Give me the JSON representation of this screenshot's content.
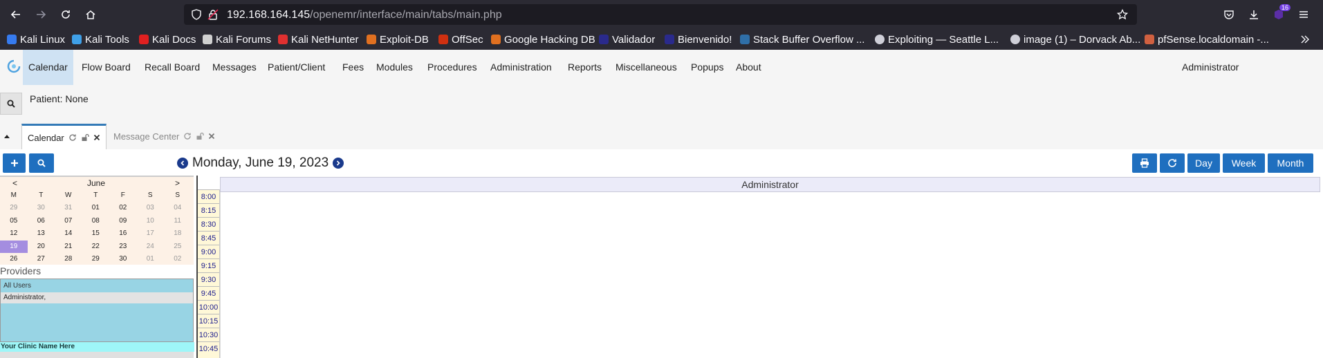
{
  "browser": {
    "url_host": "192.168.164.145",
    "url_path": "/openemr/interface/main/tabs/main.php",
    "badge_count": "16",
    "bookmarks": [
      {
        "label": "Kali Linux",
        "color": "#367bf0"
      },
      {
        "label": "Kali Tools",
        "color": "#3fa0e8"
      },
      {
        "label": "Kali Docs",
        "color": "#e02020"
      },
      {
        "label": "Kali Forums",
        "color": "#d0d0d0"
      },
      {
        "label": "Kali NetHunter",
        "color": "#e03030"
      },
      {
        "label": "Exploit-DB",
        "color": "#e07020"
      },
      {
        "label": "OffSec",
        "color": "#d03010"
      },
      {
        "label": "Google Hacking DB",
        "color": "#e07020"
      },
      {
        "label": "Validador",
        "color": "#2a2a8c"
      },
      {
        "label": "Bienvenido!",
        "color": "#2a2a8c"
      },
      {
        "label": "Stack Buffer Overflow ...",
        "color": "#2f6fa8"
      },
      {
        "label": "Exploiting — Seattle L...",
        "color": "#cfcfd8"
      },
      {
        "label": "image (1) – Dorvack Ab...",
        "color": "#cfcfd8"
      },
      {
        "label": "pfSense.localdomain -...",
        "color": "#d06040"
      }
    ]
  },
  "app": {
    "nav": [
      "Calendar",
      "Flow Board",
      "Recall Board",
      "Messages",
      "Patient/Client",
      "Fees",
      "Modules",
      "Procedures",
      "Administration",
      "Reports",
      "Miscellaneous",
      "Popups",
      "About"
    ],
    "user": "Administrator",
    "patient_label": "Patient: None",
    "tabs": [
      {
        "label": "Calendar",
        "active": true
      },
      {
        "label": "Message Center",
        "active": false
      }
    ]
  },
  "calendar": {
    "date_title": "Monday, June 19, 2023",
    "view_buttons": [
      "Day",
      "Week",
      "Month"
    ],
    "mini": {
      "prev": "<",
      "month": "June",
      "next": ">",
      "weekdays": [
        "M",
        "T",
        "W",
        "T",
        "F",
        "S",
        "S"
      ],
      "weeks": [
        [
          "29",
          "30",
          "31",
          "01",
          "02",
          "03",
          "04"
        ],
        [
          "05",
          "06",
          "07",
          "08",
          "09",
          "10",
          "11"
        ],
        [
          "12",
          "13",
          "14",
          "15",
          "16",
          "17",
          "18"
        ],
        [
          "19",
          "20",
          "21",
          "22",
          "23",
          "24",
          "25"
        ],
        [
          "26",
          "27",
          "28",
          "29",
          "30",
          "01",
          "02"
        ]
      ],
      "muted": [
        [
          true,
          true,
          true,
          false,
          false,
          true,
          true
        ],
        [
          false,
          false,
          false,
          false,
          false,
          true,
          true
        ],
        [
          false,
          false,
          false,
          false,
          false,
          true,
          true
        ],
        [
          false,
          false,
          false,
          false,
          false,
          true,
          true
        ],
        [
          false,
          false,
          false,
          false,
          false,
          true,
          true
        ]
      ],
      "selected_week": 3,
      "selected_day": 0
    },
    "providers_title": "Providers",
    "providers": [
      "All Users",
      "Administrator,"
    ],
    "clinic": "Your Clinic Name Here",
    "provider_column": "Administrator",
    "times": [
      "8:00",
      "8:15",
      "8:30",
      "8:45",
      "9:00",
      "9:15",
      "9:30",
      "9:45",
      "10:00",
      "10:15",
      "10:30",
      "10:45"
    ]
  }
}
